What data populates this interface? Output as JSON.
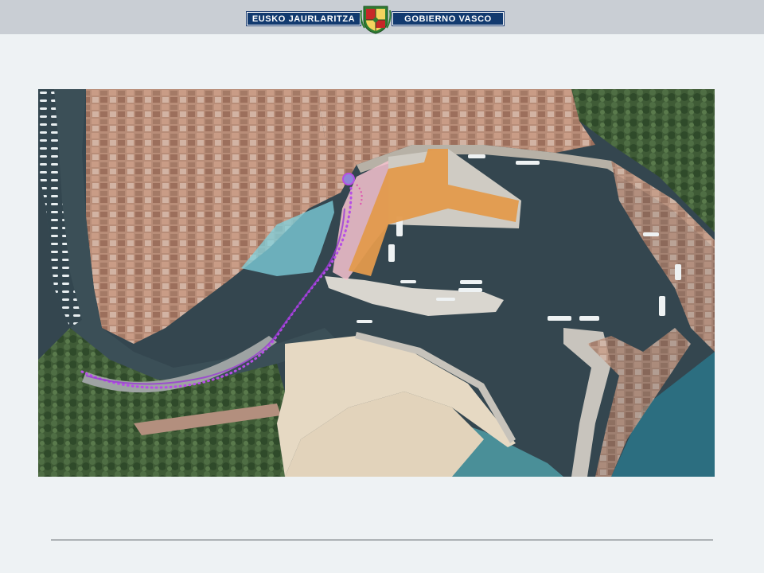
{
  "header": {
    "left_label": "EUSKO JAURLARITZA",
    "right_label": "GOBIERNO VASCO",
    "crest_icon": "basque-government-coat-of-arms-icon"
  },
  "map": {
    "overlay_colors": {
      "pier_plan": "#e39a4c",
      "pink_zone": "#f7c3cf",
      "teal_zone": "#7fd3df",
      "path_route": "#b64ee6"
    }
  }
}
